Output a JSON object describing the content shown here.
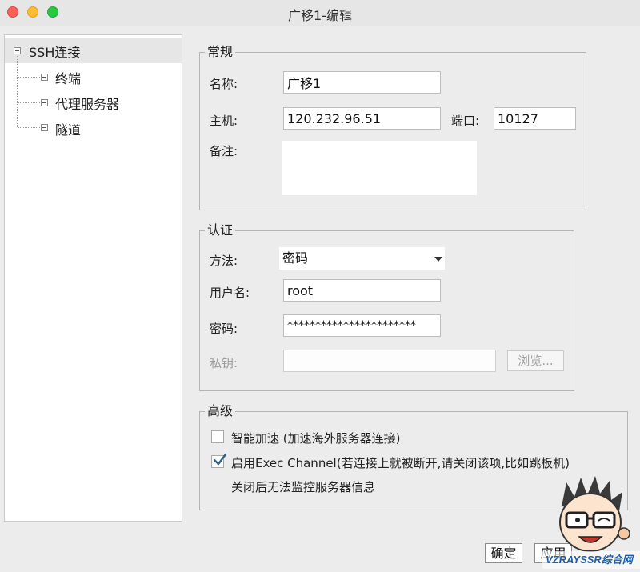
{
  "window": {
    "title": "广移1-编辑"
  },
  "tree": {
    "root": "SSH连接",
    "items": [
      {
        "label": "终端"
      },
      {
        "label": "代理服务器"
      },
      {
        "label": "隧道"
      }
    ]
  },
  "general": {
    "legend": "常规",
    "name_label": "名称:",
    "name_value": "广移1",
    "host_label": "主机:",
    "host_value": "120.232.96.51",
    "port_label": "端口:",
    "port_value": "10127",
    "notes_label": "备注:",
    "notes_value": ""
  },
  "auth": {
    "legend": "认证",
    "method_label": "方法:",
    "method_value": "密码",
    "username_label": "用户名:",
    "username_value": "root",
    "password_label": "密码:",
    "password_value": "***********************",
    "private_key_label": "私钥:",
    "private_key_value": "",
    "browse_label": "浏览..."
  },
  "advanced": {
    "legend": "高级",
    "smart_accel_label": "智能加速 (加速海外服务器连接)",
    "smart_accel_checked": false,
    "exec_channel_label": "启用Exec Channel(若连接上就被断开,请关闭该项,比如跳板机)",
    "exec_channel_checked": true,
    "exec_channel_note": "关闭后无法监控服务器信息"
  },
  "footer": {
    "ok_label": "确定",
    "apply_label": "应用"
  },
  "watermark": {
    "text": "VZRAYSSR综合网"
  }
}
